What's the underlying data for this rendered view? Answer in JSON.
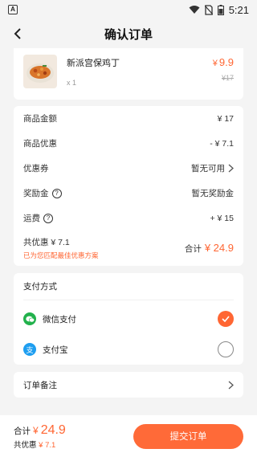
{
  "status_bar": {
    "time": "5:21",
    "app_indicator": "A"
  },
  "header": {
    "title": "确认订单"
  },
  "product": {
    "name": "新派宫保鸡丁",
    "quantity": "x 1",
    "price_symbol": "¥",
    "price": "9.9",
    "original_price": "¥17"
  },
  "summary": {
    "rows": [
      {
        "label": "商品金额",
        "value": "¥ 17"
      },
      {
        "label": "商品优惠",
        "value": "- ¥ 7.1"
      },
      {
        "label": "优惠券",
        "value": "暂无可用"
      },
      {
        "label": "奖励金",
        "value": "暂无奖励金"
      },
      {
        "label": "运费",
        "value": "+ ¥ 15"
      }
    ],
    "total_discount": "共优惠 ¥ 7.1",
    "best_plan_note": "已为您匹配最佳优惠方案",
    "total_label": "合计",
    "total_amount": "¥ 24.9"
  },
  "payment": {
    "title": "支付方式",
    "options": [
      {
        "label": "微信支付",
        "selected": true
      },
      {
        "label": "支付宝",
        "selected": false
      }
    ]
  },
  "note": {
    "label": "订单备注"
  },
  "bottom_bar": {
    "total_label": "合计",
    "total_symbol": "¥",
    "total_amount": "24.9",
    "discount_label": "共优惠",
    "discount_amount": "¥ 7.1",
    "submit_label": "提交订单"
  },
  "colors": {
    "accent": "#ff6633",
    "wechat": "#22b14c",
    "alipay": "#1e9ef0"
  }
}
